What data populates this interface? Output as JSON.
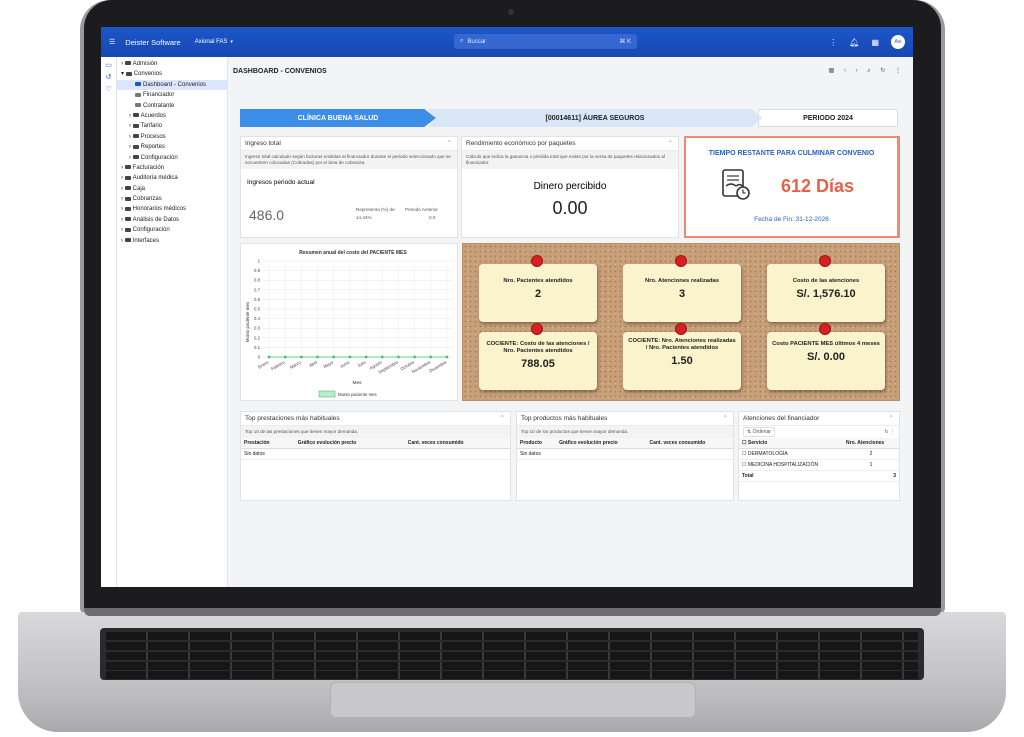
{
  "app": {
    "brand": "Deister Software",
    "org": "Axional FAS",
    "search_placeholder": "Buscar",
    "search_shortcut": "⌘ K",
    "avatar": "Axi"
  },
  "tree": [
    "Admisión",
    "Convenios",
    "Dashboard - Convenios",
    "Financiador",
    "Contratante",
    "Acuerdos",
    "Tarifario",
    "Procesos",
    "Reportes",
    "Configuración",
    "Facturación",
    "Auditoría médica",
    "Caja",
    "Cobranzas",
    "Honorarios médicos",
    "Análisis de Datos",
    "Configuración",
    "Interfaces"
  ],
  "page_title": "DASHBOARD - CONVENIOS",
  "steps": {
    "clinic": "CLÍNICA BUENA SALUD",
    "insurer": "[00014611] ÁUREA SEGUROS",
    "period": "PERIODO 2024"
  },
  "ingreso": {
    "title": "Ingreso total",
    "desc": "Ingreso total calculado según facturas emitidas al financiador durante el periodo seleccionado que se encuentren colocadas (Cobradas) por el área de cobranza.",
    "label": "Ingresos periodo actual",
    "value": "486.0",
    "rep_label": "Representa (%) de:",
    "prev_label": "Periodo Anterior",
    "rep_value": "14.44%",
    "prev_value": "0.0"
  },
  "rendimiento": {
    "title": "Rendimiento económico por paquetes",
    "desc": "Cálculo que indica la ganancia o pérdida total que existe por la venta de paquetes relacionados al financiador.",
    "label": "Dinero percibido",
    "value": "0.00"
  },
  "tiempo": {
    "title": "TIEMPO RESTANTE PARA CULMINAR CONVENIO",
    "value": "612 Días",
    "fecha": "Fecha de Fin: 31-12-2026"
  },
  "chart_data": {
    "type": "line",
    "title": "Resumen anual del costo del PACIENTE MES",
    "xlabel": "Mes",
    "ylabel": "Monto paciente mes",
    "categories": [
      "Enero",
      "Febrero",
      "Marzo",
      "Abril",
      "Mayo",
      "Junio",
      "Julio",
      "Agosto",
      "Septiembre",
      "Octubre",
      "Noviembre",
      "Diciembre"
    ],
    "series": [
      {
        "name": "Monto paciente mes",
        "values": [
          0,
          0,
          0,
          0,
          0,
          0,
          0,
          0,
          0,
          0,
          0,
          0
        ],
        "color": "#3cc36a"
      }
    ],
    "ylim": [
      0,
      1
    ],
    "yticks": [
      "1",
      "0.9",
      "0.8",
      "0.7",
      "0.6",
      "0.5",
      "0.4",
      "0.3",
      "0.2",
      "0.1",
      "0"
    ],
    "legend": "bottom"
  },
  "notes": [
    {
      "label": "Nro. Pacientes atendidos",
      "value": "2"
    },
    {
      "label": "Nro. Atenciones realizadas",
      "value": "3"
    },
    {
      "label": "Costo de las atenciones",
      "value": "S/. 1,576.10"
    },
    {
      "label": "COCIENTE: Costo de las atenciones / Nro. Pacientes atendidos",
      "value": "788.05"
    },
    {
      "label": "COCIENTE: Nro. Atenciones realizadas / Nro. Pacientes atendidos",
      "value": "1.50"
    },
    {
      "label": "Costo PACIENTE MES últimos 4 meses",
      "value": "S/. 0.00"
    }
  ],
  "prestaciones": {
    "title": "Top prestaciones más habituales",
    "desc": "Top 10 de las prestaciones que tienen mayor demanda.",
    "cols": [
      "Prestación",
      "Gráfico evolución precio",
      "Cant. veces consumido"
    ],
    "empty": "Sin datos"
  },
  "productos": {
    "title": "Top productos más habituales",
    "desc": "Top 10 de los productos que tienen mayor demanda.",
    "cols": [
      "Producto",
      "Gráfico evolución precio",
      "Cant. veces consumido"
    ],
    "empty": "Sin datos"
  },
  "atenciones": {
    "title": "Atenciones del financiador",
    "sort_label": "Ordenar",
    "cols": [
      "Servicio",
      "Nro. Atenciones"
    ],
    "rows": [
      {
        "servicio": "DERMATOLOGÍA",
        "n": "2"
      },
      {
        "servicio": "MEDICINA HOSPITALIZACIÓN",
        "n": "1"
      }
    ],
    "total_label": "Total",
    "total": "3"
  }
}
